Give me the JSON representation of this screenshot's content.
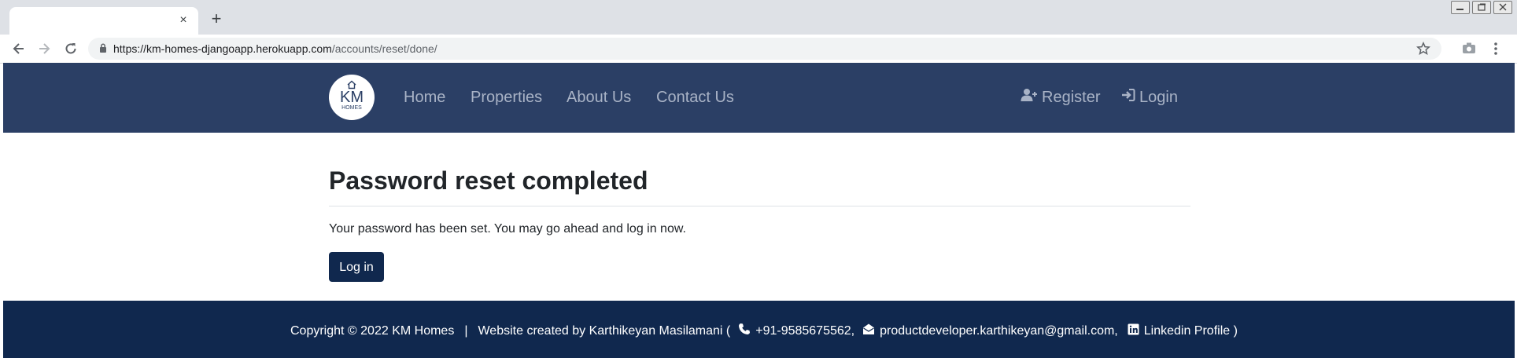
{
  "browser": {
    "tab_close_glyph": "×",
    "new_tab_glyph": "+",
    "url_host": "https://km-homes-djangoapp.herokuapp.com",
    "url_path": "/accounts/reset/done/"
  },
  "nav": {
    "logo_text": "KM",
    "logo_sub": "HOMES",
    "links": [
      "Home",
      "Properties",
      "About Us",
      "Contact Us"
    ],
    "register": "Register",
    "login": "Login"
  },
  "main": {
    "title": "Password reset completed",
    "message": "Your password has been set. You may go ahead and log in now.",
    "login_button": "Log in"
  },
  "footer": {
    "copyright": "Copyright © 2022 KM Homes",
    "separator": "|",
    "created_by": "Website created by Karthikeyan Masilamani (",
    "phone": "+91-9585675562,",
    "email": "productdeveloper.karthikeyan@gmail.com,",
    "linkedin": "Linkedin Profile )"
  },
  "colors": {
    "navbar": "#2b3f65",
    "footer": "#10284e",
    "button": "#10284e",
    "nav_link": "#a9b3c6"
  },
  "icons": [
    "close-icon",
    "plus-icon",
    "back-arrow-icon",
    "forward-arrow-icon",
    "reload-icon",
    "lock-icon",
    "star-icon",
    "camera-icon",
    "kebab-menu-icon",
    "house-icon",
    "user-plus-icon",
    "sign-in-icon",
    "phone-icon",
    "envelope-open-icon",
    "linkedin-icon"
  ]
}
